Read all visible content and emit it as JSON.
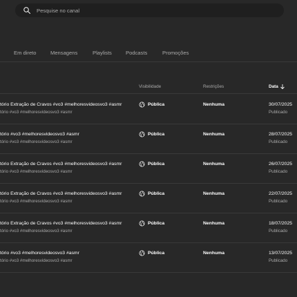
{
  "search": {
    "placeholder": "Pesquise no canal"
  },
  "tabs": [
    "Em direto",
    "Mensagens",
    "Playlists",
    "Podcasts",
    "Promoções"
  ],
  "table": {
    "headers": {
      "visibility": "Visibilidade",
      "restrictions": "Restrições",
      "date": "Data"
    },
    "rows": [
      {
        "title": "tório Extração de Cravos #vo3 #melhoresvideosvo3 #asmr",
        "description": "tório #vo3 #melhoresvideosvo3 #asmr",
        "visibility": "Pública",
        "restrictions": "Nenhuma",
        "date": "30/07/2025",
        "status": "Publicado"
      },
      {
        "title": "tório #vo3 #melhoresvideosvo3 #asmr",
        "description": "tório #vo3 #melhoresvideosvo3 #asmr",
        "visibility": "Pública",
        "restrictions": "Nenhuma",
        "date": "28/07/2025",
        "status": "Publicado"
      },
      {
        "title": "tório Extração de Cravos #vo3 #melhoresvideosvo3 #asmr",
        "description": "tório #vo3 #melhoresvideosvo3 #asmr",
        "visibility": "Pública",
        "restrictions": "Nenhuma",
        "date": "26/07/2025",
        "status": "Publicado"
      },
      {
        "title": "tório Extração de Cravos #vo3 #melhoresvideosvo3 #asmr",
        "description": "tório #vo3 #melhoresvideosvo3 #asmr",
        "visibility": "Pública",
        "restrictions": "Nenhuma",
        "date": "22/07/2025",
        "status": "Publicado"
      },
      {
        "title": "tório Extração de Cravos #vo3 #melhoresvideosvo3 #asmr",
        "description": "tório #vo3 #melhoresvideosvo3 #asmr",
        "visibility": "Pública",
        "restrictions": "Nenhuma",
        "date": "18/07/2025",
        "status": "Publicado"
      },
      {
        "title": "tório #vo3 #melhoresvideosvo3 #asmr",
        "description": "tório #vo3 #melhoresvideosvo3 #asmr",
        "visibility": "Pública",
        "restrictions": "Nenhuma",
        "date": "13/07/2025",
        "status": "Publicado"
      }
    ]
  },
  "icons": {
    "search": "search-icon",
    "sort": "arrow-down-icon",
    "visibility": "globe-icon"
  },
  "colors": {
    "background": "#282828",
    "search_bg": "#1f1f1f",
    "text_primary": "#ffffff",
    "text_secondary": "#aaaaaa",
    "divider": "#3a3a3a"
  }
}
